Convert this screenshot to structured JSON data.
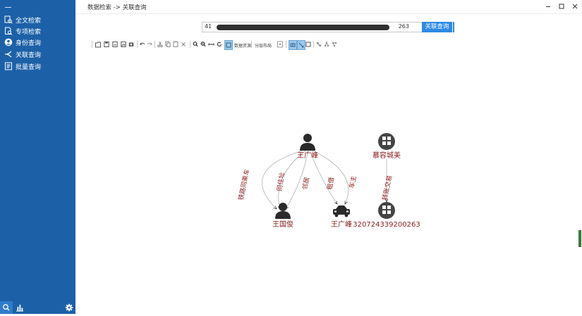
{
  "sidebar": {
    "items": [
      {
        "label": "全文检索",
        "icon": "search-doc-icon"
      },
      {
        "label": "专项检索",
        "icon": "doc-search-icon"
      },
      {
        "label": "身份查询",
        "icon": "user-circle-icon"
      },
      {
        "label": "关联查询",
        "icon": "relation-icon"
      },
      {
        "label": "批量查询",
        "icon": "batch-list-icon"
      }
    ],
    "bottom_icons": [
      "search-icon",
      "bar-chart-icon",
      "gear-icon"
    ]
  },
  "titlebar": {
    "title": "数据检索 -> 关联查询"
  },
  "search": {
    "value_prefix": "41",
    "value_suffix": "263",
    "button_label": "关联查询"
  },
  "toolbar": {
    "label_1": "数据资源",
    "label_2": "分层布局"
  },
  "graph": {
    "nodes": [
      {
        "id": "person-1",
        "label": "王广峰",
        "type": "person"
      },
      {
        "id": "person-2",
        "label": "王国俊",
        "type": "person"
      },
      {
        "id": "car-1",
        "label": "王广峰",
        "type": "car"
      },
      {
        "id": "bank-1",
        "label": "慕容城美",
        "type": "bank"
      },
      {
        "id": "bank-2",
        "label": "320724339200263",
        "type": "bank"
      }
    ],
    "edges": [
      {
        "from": "person-1",
        "to": "person-2",
        "label": "铁路同乘车"
      },
      {
        "from": "person-1",
        "to": "person-2",
        "label": "同住址"
      },
      {
        "from": "person-1",
        "to": "person-2",
        "label": "邻居"
      },
      {
        "from": "person-1",
        "to": "car-1",
        "label": "租借"
      },
      {
        "from": "person-1",
        "to": "car-1",
        "label": "车主"
      },
      {
        "from": "bank-1",
        "to": "bank-2",
        "label": "转账交易"
      }
    ]
  },
  "colors": {
    "sidebar": "#1c61a8",
    "accent": "#2d8ae6",
    "node_label": "#8b1a1a",
    "edge": "#b0b0b0"
  }
}
